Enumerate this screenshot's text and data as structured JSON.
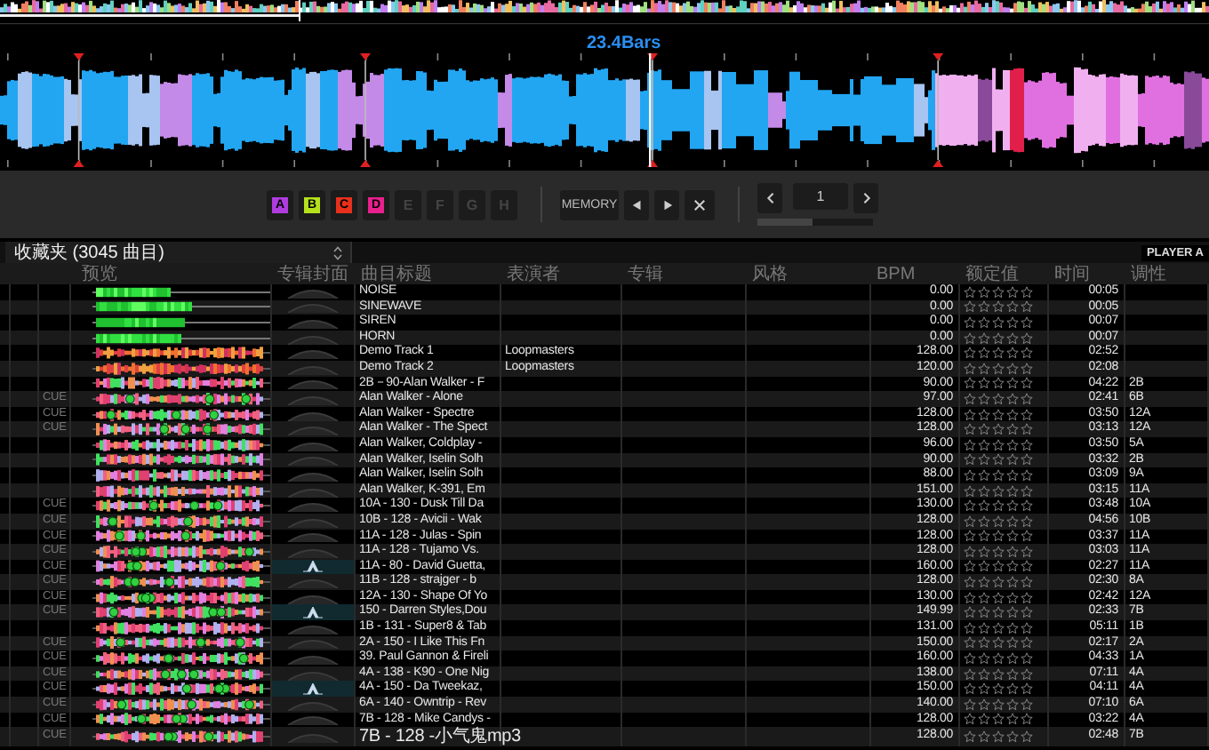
{
  "deck": {
    "position_label": "23.4Bars"
  },
  "hot_cues": [
    {
      "label": "A",
      "set": true,
      "color": "#b03ce0"
    },
    {
      "label": "B",
      "set": true,
      "color": "#b4e01c"
    },
    {
      "label": "C",
      "set": true,
      "color": "#e8301c"
    },
    {
      "label": "D",
      "set": true,
      "color": "#e8208c"
    },
    {
      "label": "E",
      "set": false
    },
    {
      "label": "F",
      "set": false
    },
    {
      "label": "G",
      "set": false
    },
    {
      "label": "H",
      "set": false
    }
  ],
  "memory": {
    "label": "MEMORY"
  },
  "page_nav": {
    "value": "1",
    "level": 0.48
  },
  "browser": {
    "title": "收藏夹 (3045 曲目)",
    "player_button": "PLAYER A"
  },
  "columns": [
    "预览",
    "专辑封面",
    "曲目标题",
    "表演者",
    "专辑",
    "风格",
    "BPM",
    "额定值",
    "时间",
    "调性"
  ],
  "rows": [
    {
      "kind": "sample",
      "title": "NOISE",
      "bpm": "0.00",
      "stars": 0,
      "time": "00:05",
      "artwork": false
    },
    {
      "kind": "sample",
      "title": "SINEWAVE",
      "bpm": "0.00",
      "stars": 0,
      "time": "00:05",
      "artwork": false
    },
    {
      "kind": "sample",
      "title": "SIREN",
      "bpm": "0.00",
      "stars": 0,
      "time": "00:07",
      "artwork": false
    },
    {
      "kind": "sample",
      "title": "HORN",
      "bpm": "0.00",
      "stars": 0,
      "time": "00:07",
      "artwork": false
    },
    {
      "kind": "demo",
      "title": "Demo Track 1",
      "artist": "Loopmasters",
      "bpm": "128.00",
      "stars": 0,
      "time": "02:52",
      "artwork": false
    },
    {
      "kind": "demo",
      "title": "Demo Track 2",
      "artist": "Loopmasters",
      "bpm": "120.00",
      "stars": 0,
      "time": "02:08",
      "artwork": false
    },
    {
      "kind": "track",
      "title": "2B－90-Alan Walker - F",
      "bpm": "90.00",
      "stars": 0,
      "time": "04:22",
      "key": "2B",
      "artwork": false
    },
    {
      "kind": "track",
      "cue": "CUE",
      "title": "Alan Walker - Alone",
      "bpm": "97.00",
      "stars": 0,
      "time": "02:41",
      "key": "6B",
      "artwork": false
    },
    {
      "kind": "track",
      "cue": "CUE",
      "title": "Alan Walker - Spectre",
      "bpm": "128.00",
      "stars": 0,
      "time": "03:50",
      "key": "12A",
      "artwork": false
    },
    {
      "kind": "track",
      "cue": "CUE",
      "title": "Alan Walker - The Spect",
      "bpm": "128.00",
      "stars": 0,
      "time": "03:13",
      "key": "12A",
      "artwork": false
    },
    {
      "kind": "track",
      "title": "Alan Walker, Coldplay -",
      "bpm": "96.00",
      "stars": 0,
      "time": "03:50",
      "key": "5A",
      "artwork": false
    },
    {
      "kind": "track",
      "title": "Alan Walker, Iselin Solh",
      "bpm": "90.00",
      "stars": 0,
      "time": "03:32",
      "key": "2B",
      "artwork": false
    },
    {
      "kind": "track",
      "title": "Alan Walker, Iselin Solh",
      "bpm": "88.00",
      "stars": 0,
      "time": "03:09",
      "key": "9A",
      "artwork": false
    },
    {
      "kind": "track",
      "title": "Alan Walker, K-391, Em",
      "bpm": "151.00",
      "stars": 0,
      "time": "03:15",
      "key": "11A",
      "artwork": false
    },
    {
      "kind": "track",
      "cue": "CUE",
      "title": "10A - 130 - Dusk Till Da",
      "bpm": "130.00",
      "stars": 0,
      "time": "03:48",
      "key": "10A",
      "artwork": false
    },
    {
      "kind": "track",
      "cue": "CUE",
      "title": "10B - 128 - Avicii  - Wak",
      "bpm": "128.00",
      "stars": 0,
      "time": "04:56",
      "key": "10B",
      "artwork": false
    },
    {
      "kind": "track",
      "cue": "CUE",
      "title": "11A - 128 - Julas  -  Spin",
      "bpm": "128.00",
      "stars": 0,
      "time": "03:37",
      "key": "11A",
      "artwork": false
    },
    {
      "kind": "track",
      "cue": "CUE",
      "title": "11A - 128 - Tujamo Vs.",
      "bpm": "128.00",
      "stars": 0,
      "time": "03:03",
      "key": "11A",
      "artwork": false
    },
    {
      "kind": "track",
      "cue": "CUE",
      "title": "11A - 80 - David Guetta,",
      "bpm": "160.00",
      "stars": 0,
      "time": "02:27",
      "key": "11A",
      "artwork": true
    },
    {
      "kind": "track",
      "cue": "CUE",
      "title": "11B - 128 - strajger  -  b",
      "bpm": "128.00",
      "stars": 0,
      "time": "02:30",
      "key": "8A",
      "artwork": false
    },
    {
      "kind": "track",
      "cue": "CUE",
      "title": "12A - 130 - Shape Of Yo",
      "bpm": "130.00",
      "stars": 0,
      "time": "02:42",
      "key": "12A",
      "artwork": false
    },
    {
      "kind": "track",
      "cue": "CUE",
      "title": "150 - Darren Styles,Dou",
      "bpm": "149.99",
      "stars": 0,
      "time": "02:33",
      "key": "7B",
      "artwork": true
    },
    {
      "kind": "track",
      "title": "1B - 131 - Super8 & Tab",
      "bpm": "131.00",
      "stars": 0,
      "time": "05:11",
      "key": "1B",
      "artwork": false
    },
    {
      "kind": "track",
      "cue": "CUE",
      "title": "2A - 150 - I Like This Fn",
      "bpm": "150.00",
      "stars": 0,
      "time": "02:17",
      "key": "2A",
      "artwork": false
    },
    {
      "kind": "track",
      "cue": "CUE",
      "title": "39. Paul Gannon & Fireli",
      "bpm": "160.00",
      "stars": 0,
      "time": "04:33",
      "key": "1A",
      "artwork": false
    },
    {
      "kind": "track",
      "cue": "CUE",
      "title": "4A - 138 - K90 - One Nig",
      "bpm": "138.00",
      "stars": 0,
      "time": "07:11",
      "key": "4A",
      "artwork": false
    },
    {
      "kind": "track",
      "cue": "CUE",
      "title": "4A - 150 - Da Tweekaz,",
      "bpm": "150.00",
      "stars": 0,
      "time": "04:11",
      "key": "4A",
      "artwork": true
    },
    {
      "kind": "track",
      "cue": "CUE",
      "title": "6A - 140 - Owntrip - Rev",
      "bpm": "140.00",
      "stars": 0,
      "time": "07:10",
      "key": "6A",
      "artwork": false
    },
    {
      "kind": "track",
      "cue": "CUE",
      "title": "7B - 128 - Mike Candys -",
      "bpm": "128.00",
      "stars": 0,
      "time": "03:22",
      "key": "4A",
      "artwork": false
    },
    {
      "kind": "track",
      "cue": "CUE",
      "title": "7B - 128 -小气鬼mp3",
      "bpm": "128.00",
      "stars": 0,
      "time": "02:48",
      "key": "7B",
      "artwork": false
    }
  ]
}
